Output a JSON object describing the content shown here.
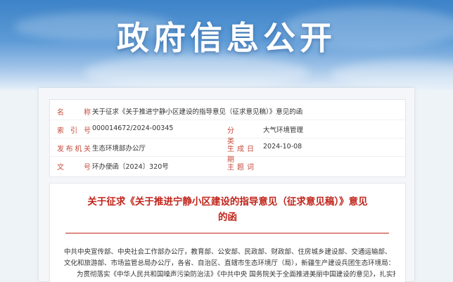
{
  "banner": {
    "title": "政府信息公开"
  },
  "info": {
    "name_label": "名　　称",
    "name_value": "关于征求《关于推进宁静小区建设的指导意见（征求意见稿）》意见的函",
    "index_label": "索 引 号",
    "index_value": "000014672/2024-00345",
    "category_label": "分　　类",
    "category_value": "大气环境管理",
    "issuer_label": "发布机关",
    "issuer_value": "生态环境部办公厅",
    "date_label": "生成日期",
    "date_value": "2024-10-08",
    "docno_label": "文　　号",
    "docno_value": "环办便函〔2024〕320号",
    "keywords_label": "主 题 词",
    "keywords_value": ""
  },
  "document": {
    "title_line1": "关于征求《关于推进宁静小区建设的指导意见（征求意见稿）》意见",
    "title_line2": "的函",
    "recipients": "中共中央宣传部、中央社会工作部办公厅，教育部、公安部、民政部、财政部、住房城乡建设部、交通运输部、文化和旅游部、市场监管总局办公厅，各省、自治区、直辖市生态环境厅（局），新疆生产建设兵团生态环境局：",
    "para1": "为贯彻落实《中华人民共和国噪声污染防治法》《中共中央 国务院关于全面推进美丽中国建设的意见》，扎实推进"
  },
  "colors": {
    "accent": "#c0241a",
    "label": "#c64b3d",
    "banner": "#3d83c8"
  }
}
